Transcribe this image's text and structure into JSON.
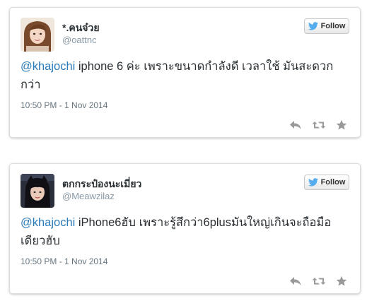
{
  "tweets": [
    {
      "name": "*.คนจ๋วย",
      "handle": "@oattnc",
      "follow_label": "Follow",
      "mention": "@khajochi",
      "text": " iphone 6 ค่ะ เพราะขนาดกำลังดี เวลาใช้ มันสะดวกกว่า",
      "timestamp": "10:50 PM - 1 Nov 2014"
    },
    {
      "name": "ตกกระป๋องนะเมี่ยว",
      "handle": "@Meawzilaz",
      "follow_label": "Follow",
      "mention": "@khajochi",
      "text": " iPhone6ฮับ เพราะรู้สึกว่า6plusมันใหญ่เกินจะถือมือเดียวฮับ",
      "timestamp": "10:50 PM - 1 Nov 2014"
    }
  ],
  "icons": [
    "twitter-bird-icon",
    "reply-icon",
    "retweet-icon",
    "favorite-icon"
  ],
  "colors": {
    "mention": "#2b7bb9",
    "handle": "#8899a6",
    "twitter_blue": "#55acee",
    "action_gray": "#999999"
  }
}
